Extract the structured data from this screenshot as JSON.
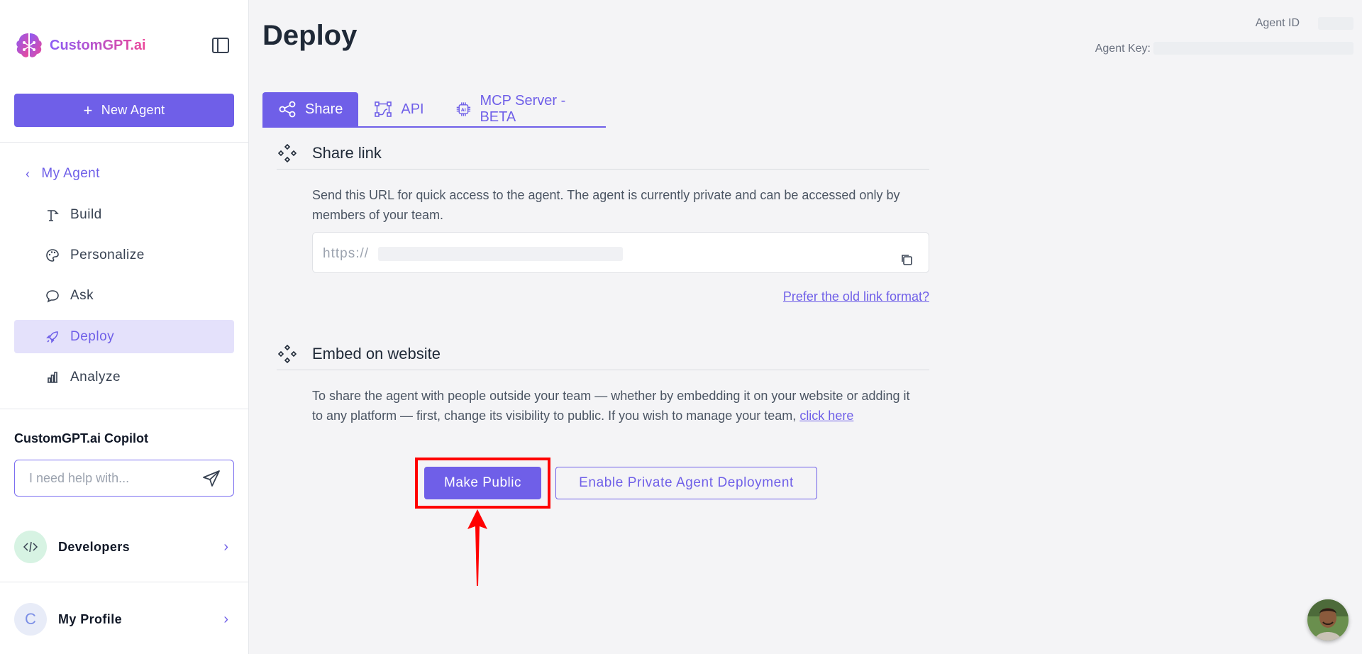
{
  "app": {
    "brand": "CustomGPT.ai"
  },
  "sidebar": {
    "new_agent_label": "New Agent",
    "back_label": "My Agent",
    "items": [
      {
        "label": "Build",
        "icon": "build-icon"
      },
      {
        "label": "Personalize",
        "icon": "palette-icon"
      },
      {
        "label": "Ask",
        "icon": "chat-icon"
      },
      {
        "label": "Deploy",
        "icon": "rocket-icon",
        "active": true
      },
      {
        "label": "Analyze",
        "icon": "chart-icon"
      }
    ],
    "copilot": {
      "title": "CustomGPT.ai Copilot",
      "placeholder": "I need help with..."
    },
    "developers_label": "Developers",
    "profile": {
      "label": "My Profile",
      "initial": "C"
    }
  },
  "header": {
    "title": "Deploy",
    "agent_id_label": "Agent ID",
    "agent_key_label": "Agent Key:"
  },
  "tabs": [
    {
      "label": "Share",
      "icon": "share-icon",
      "active": true
    },
    {
      "label": "API",
      "icon": "api-icon"
    },
    {
      "label": "MCP Server - BETA",
      "icon": "chip-icon"
    }
  ],
  "share": {
    "title": "Share link",
    "description": "Send this URL for quick access to the agent. The agent is currently private and can be accessed only by members of your team.",
    "url_prefix": "https://",
    "old_link": "Prefer the old link format?"
  },
  "embed": {
    "title": "Embed on website",
    "description": "To share the agent with people outside your team — whether by embedding it on your website or adding it to any platform — first, change its visibility to public. If you wish to manage your team,",
    "link": "click here",
    "make_public": "Make Public",
    "private_deploy": "Enable Private Agent Deployment"
  },
  "colors": {
    "accent": "#6f5fe8",
    "highlight": "#ff0000"
  }
}
